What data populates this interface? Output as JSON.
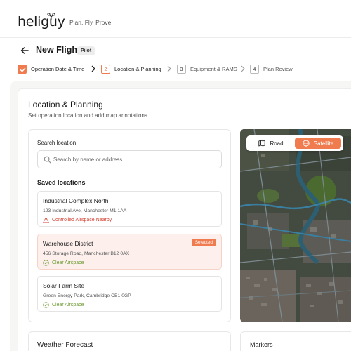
{
  "brand": {
    "name": "heliguy",
    "tagline": "Plan. Fly. Prove."
  },
  "header": {
    "title": "New Flight",
    "role_badge": "Pilot"
  },
  "steps": [
    {
      "number": "",
      "label": "Operation Date & Time",
      "state": "done"
    },
    {
      "number": "2",
      "label": "Location & Planning",
      "state": "active"
    },
    {
      "number": "3",
      "label": "Equipment & RAMS",
      "state": "upcoming"
    },
    {
      "number": "4",
      "label": "Plan Review",
      "state": "upcoming"
    }
  ],
  "section": {
    "title": "Location & Planning",
    "subtitle": "Set operation location and add map annotations"
  },
  "search": {
    "label": "Search location",
    "placeholder": "Search by name or address..."
  },
  "saved": {
    "title": "Saved locations",
    "items": [
      {
        "name": "Industrial Complex North",
        "address": "123 Industrial Ave, Manchester M1 1AA",
        "status": "Controlled Airspace Nearby",
        "status_type": "warning",
        "selected": false
      },
      {
        "name": "Warehouse District",
        "address": "456 Storage Road, Manchester B12 0AX",
        "status": "Clear Airspace",
        "status_type": "clear",
        "selected": true,
        "badge": "Selected"
      },
      {
        "name": "Solar Farm Site",
        "address": "Green Energy Park, Cambridge CB1 0GP",
        "status": "Clear Airspace",
        "status_type": "clear",
        "selected": false
      }
    ]
  },
  "map": {
    "road_label": "Road",
    "satellite_label": "Satellite",
    "active_view": "satellite"
  },
  "weather": {
    "title": "Weather Forecast"
  },
  "markers": {
    "title": "Markers"
  },
  "colors": {
    "accent": "#f07b4f",
    "warning": "#d43f2f",
    "clear": "#6b9a2f"
  }
}
